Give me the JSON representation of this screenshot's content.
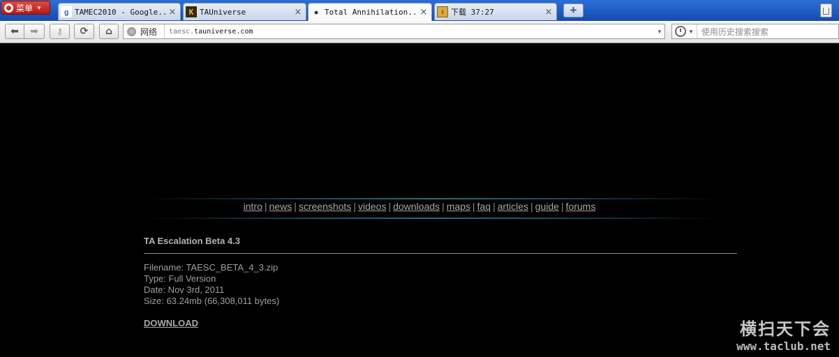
{
  "browser": {
    "menu_label": "菜单",
    "tabs": [
      {
        "label": "TAMEC2010 - Google...",
        "icon": "google-favicon"
      },
      {
        "label": "TAUniverse",
        "icon": "tauniverse-favicon"
      },
      {
        "label": "Total Annihilation...",
        "icon": "ta-favicon",
        "active": true
      },
      {
        "label": "下载 37:27",
        "icon": "download-icon"
      }
    ],
    "tab_close": "×",
    "new_tab": "+",
    "address": {
      "security_label": "网络",
      "url_prefix": "taesc.",
      "url_domain": "tauniverse.com"
    },
    "search": {
      "placeholder": "使用历史搜索搜索"
    }
  },
  "page": {
    "nav": [
      "intro",
      "news",
      "screenshots",
      "videos",
      "downloads",
      "maps",
      "faq",
      "articles",
      "guide",
      "forums"
    ],
    "nav_separator": "|",
    "download": {
      "title": "TA Escalation Beta 4.3",
      "filename": "Filename: TAESC_BETA_4_3.zip",
      "type": "Type: Full Version",
      "date": "Date: Nov 3rd, 2011",
      "size": "Size: 63.24mb (66,308,011 bytes)",
      "link": "DOWNLOAD"
    },
    "watermark": {
      "name": "横扫天下会",
      "url": "www.taclub.net"
    }
  }
}
